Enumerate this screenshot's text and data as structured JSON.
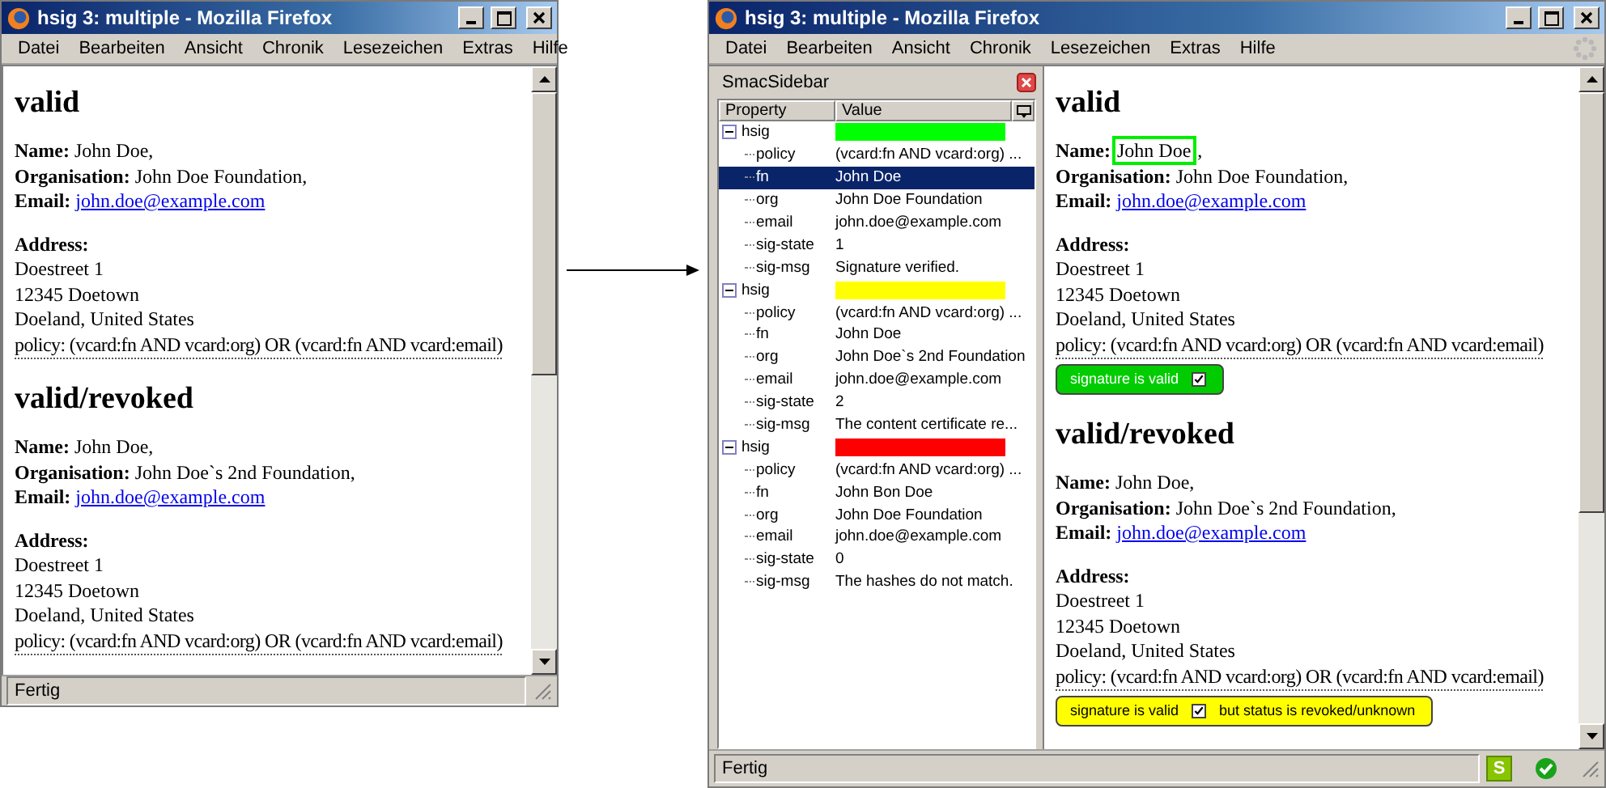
{
  "windows": [
    {
      "title": "hsig 3: multiple - Mozilla Firefox",
      "menu": [
        "Datei",
        "Bearbeiten",
        "Ansicht",
        "Chronik",
        "Lesezeichen",
        "Extras",
        "Hilfe"
      ],
      "sections": [
        {
          "heading": "valid",
          "fields": [
            {
              "label": "Name:",
              "value": "John Doe",
              "suffix": ",",
              "kind": "text"
            },
            {
              "label": "Organisation:",
              "value": "John Doe Foundation,",
              "kind": "text"
            },
            {
              "label": "Email:",
              "value": "john.doe@example.com",
              "kind": "link"
            }
          ],
          "address_label": "Address:",
          "address": [
            "Doestreet 1",
            "12345 Doetown",
            "Doeland, United States"
          ],
          "policy": "policy: (vcard:fn AND vcard:org) OR (vcard:fn AND vcard:email)"
        },
        {
          "heading": "valid/revoked",
          "fields": [
            {
              "label": "Name:",
              "value": "John Doe,",
              "kind": "text"
            },
            {
              "label": "Organisation:",
              "value": "John Doe`s 2nd Foundation,",
              "kind": "text"
            },
            {
              "label": "Email:",
              "value": "john.doe@example.com",
              "kind": "link"
            }
          ],
          "address_label": "Address:",
          "address": [
            "Doestreet 1",
            "12345 Doetown",
            "Doeland, United States"
          ],
          "policy": "policy: (vcard:fn AND vcard:org) OR (vcard:fn AND vcard:email)"
        }
      ],
      "status": "Fertig"
    },
    {
      "title": "hsig 3: multiple - Mozilla Firefox",
      "menu": [
        "Datei",
        "Bearbeiten",
        "Ansicht",
        "Chronik",
        "Lesezeichen",
        "Extras",
        "Hilfe"
      ],
      "sidebar": {
        "title": "SmacSidebar",
        "columns": [
          "Property",
          "Value"
        ],
        "groups": [
          {
            "label": "hsig",
            "color": "#00ff00",
            "expanded": true,
            "children": [
              {
                "property": "policy",
                "value": "(vcard:fn AND vcard:org) ...",
                "selected": false
              },
              {
                "property": "fn",
                "value": "John Doe",
                "selected": true
              },
              {
                "property": "org",
                "value": "John Doe Foundation",
                "selected": false
              },
              {
                "property": "email",
                "value": "john.doe@example.com",
                "selected": false
              },
              {
                "property": "sig-state",
                "value": "1",
                "selected": false
              },
              {
                "property": "sig-msg",
                "value": "Signature verified.",
                "selected": false
              }
            ]
          },
          {
            "label": "hsig",
            "color": "#ffff00",
            "expanded": true,
            "children": [
              {
                "property": "policy",
                "value": "(vcard:fn AND vcard:org) ...",
                "selected": false
              },
              {
                "property": "fn",
                "value": "John Doe",
                "selected": false
              },
              {
                "property": "org",
                "value": "John Doe`s 2nd Foundation",
                "selected": false
              },
              {
                "property": "email",
                "value": "john.doe@example.com",
                "selected": false
              },
              {
                "property": "sig-state",
                "value": "2",
                "selected": false
              },
              {
                "property": "sig-msg",
                "value": "The content certificate re...",
                "selected": false
              }
            ]
          },
          {
            "label": "hsig",
            "color": "#ff0000",
            "expanded": true,
            "children": [
              {
                "property": "policy",
                "value": "(vcard:fn AND vcard:org) ...",
                "selected": false
              },
              {
                "property": "fn",
                "value": "John Bon Doe",
                "selected": false
              },
              {
                "property": "org",
                "value": "John Doe Foundation",
                "selected": false
              },
              {
                "property": "email",
                "value": "john.doe@example.com",
                "selected": false
              },
              {
                "property": "sig-state",
                "value": "0",
                "selected": false
              },
              {
                "property": "sig-msg",
                "value": "The hashes do not match.",
                "selected": false
              }
            ]
          }
        ]
      },
      "sections": [
        {
          "heading": "valid",
          "fields": [
            {
              "label": "Name:",
              "value": "John Doe",
              "suffix": ",",
              "kind": "text",
              "highlighted": true
            },
            {
              "label": "Organisation:",
              "value": "John Doe Foundation,",
              "kind": "text"
            },
            {
              "label": "Email:",
              "value": "john.doe@example.com",
              "kind": "link"
            }
          ],
          "address_label": "Address:",
          "address": [
            "Doestreet 1",
            "12345 Doetown",
            "Doeland, United States"
          ],
          "policy": "policy: (vcard:fn AND vcard:org) OR (vcard:fn AND vcard:email)",
          "badge": {
            "kind": "valid",
            "color": "#00cc00",
            "text": "signature is valid",
            "checked": true
          }
        },
        {
          "heading": "valid/revoked",
          "fields": [
            {
              "label": "Name:",
              "value": "John Doe,",
              "kind": "text"
            },
            {
              "label": "Organisation:",
              "value": "John Doe`s 2nd Foundation,",
              "kind": "text"
            },
            {
              "label": "Email:",
              "value": "john.doe@example.com",
              "kind": "link"
            }
          ],
          "address_label": "Address:",
          "address": [
            "Doestreet 1",
            "12345 Doetown",
            "Doeland, United States"
          ],
          "policy": "policy: (vcard:fn AND vcard:org) OR (vcard:fn AND vcard:email)",
          "badge": {
            "kind": "revoked",
            "color": "#ffff00",
            "text": "signature is valid",
            "checked": true,
            "note": "but status is revoked/unknown"
          }
        }
      ],
      "status": "Fertig",
      "status_icon_label": "S"
    }
  ]
}
